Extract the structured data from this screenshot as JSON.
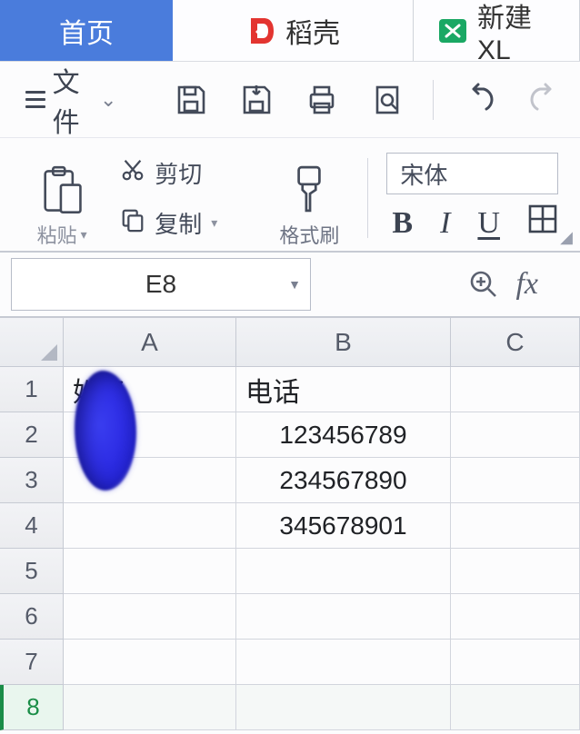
{
  "tabs": {
    "home": "首页",
    "docer": "稻壳",
    "newsheet": "新建 XL"
  },
  "ribbon1": {
    "file_label": "文件"
  },
  "ribbon2": {
    "paste_label": "粘贴",
    "cut_label": "剪切",
    "copy_label": "复制",
    "fmtpainter_label": "格式刷"
  },
  "font": {
    "family": "宋体"
  },
  "namebox": {
    "value": "E8"
  },
  "sheet": {
    "columns": [
      "A",
      "B",
      "C"
    ],
    "rows": [
      "1",
      "2",
      "3",
      "4",
      "5",
      "6",
      "7",
      "8"
    ],
    "selected_row_index": 7,
    "headers": {
      "a": "姓名",
      "b": "电话"
    },
    "data": [
      {
        "a": "",
        "b": "123456789"
      },
      {
        "a": "",
        "b": "234567890"
      },
      {
        "a": "",
        "b": "345678901"
      }
    ]
  }
}
